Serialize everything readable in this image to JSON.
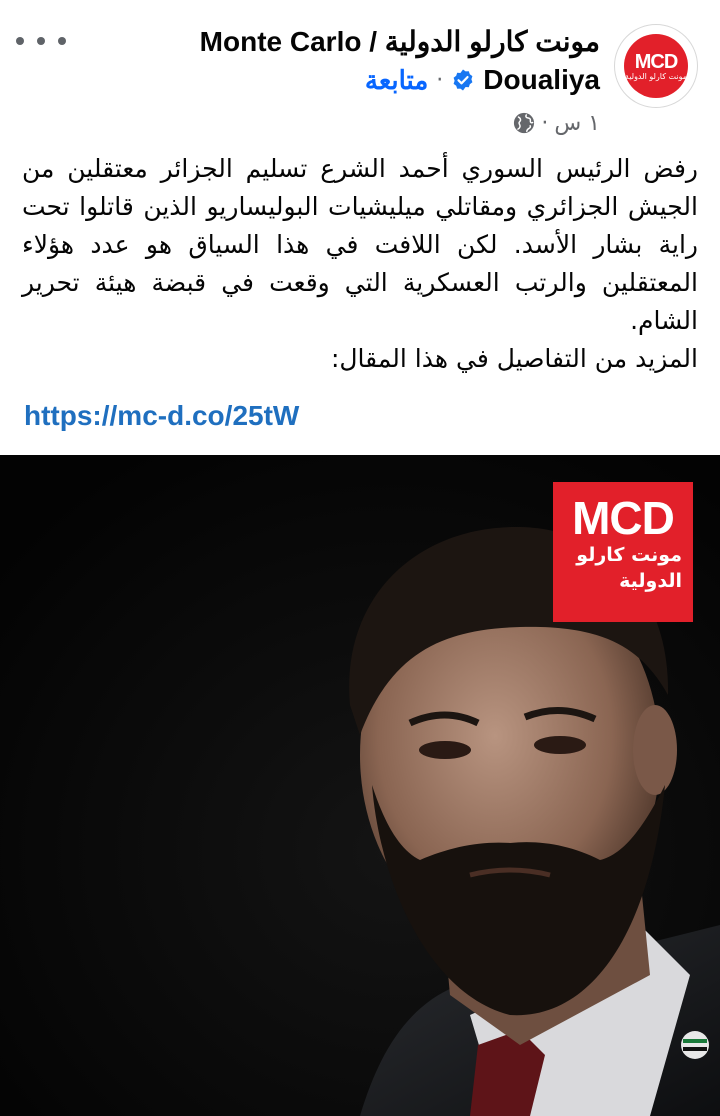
{
  "header": {
    "page_name_line1": "مونت كارلو الدولية / Monte Carlo",
    "page_name_line2": "Doualiya",
    "separator": "·",
    "follow_label": "متابعة",
    "timestamp": "١ س",
    "meta_separator": "·",
    "avatar": {
      "logo_text": "MCD",
      "logo_subtext": "مونت كارلو الدولية"
    },
    "icons": {
      "more": "more-options-icon",
      "verified": "verified-badge-icon",
      "privacy": "globe-icon"
    }
  },
  "post": {
    "paragraph": "رفض الرئيس السوري أحمد الشرع تسليم الجزائر معتقلين من الجيش الجزائري ومقاتلي ميليشيات البوليساريو الذين قاتلوا تحت راية بشار الأسد. لكن اللافت في هذا السياق هو عدد هؤلاء المعتقلين والرتب العسكرية التي وقعت في قبضة هيئة تحرير الشام.",
    "more_text": "المزيد من التفاصيل في هذا المقال:",
    "link": "https://mc-d.co/25tW"
  },
  "photo": {
    "badge_main": "MCD",
    "badge_line1": "مونت كارلو",
    "badge_line2": "الدولية"
  },
  "colors": {
    "brand_red": "#e2202a",
    "link_blue": "#1f6fbf",
    "follow_blue": "#0866ff",
    "verified_blue": "#1877f2",
    "meta_gray": "#65676b"
  }
}
